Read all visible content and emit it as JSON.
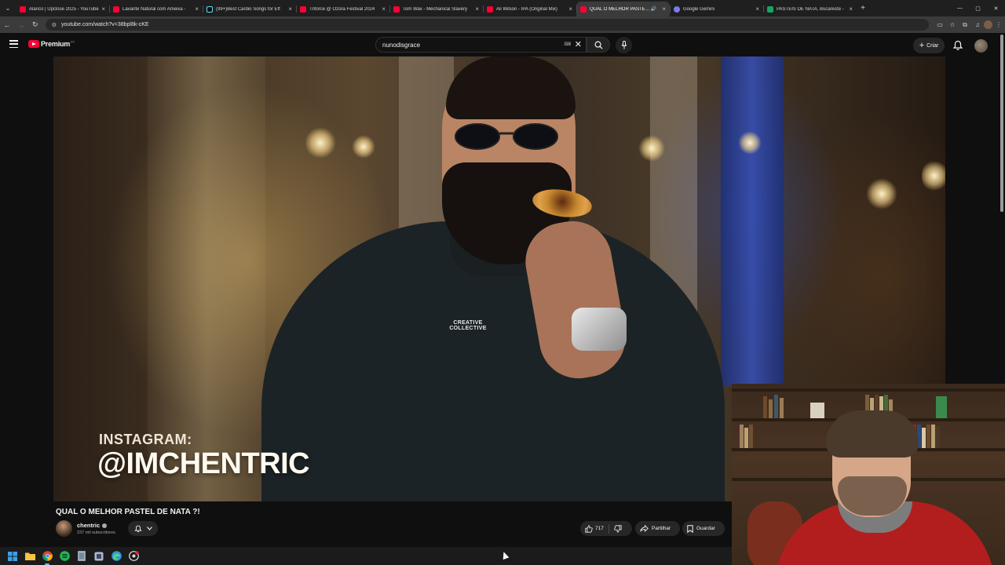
{
  "browser": {
    "tabs": [
      {
        "title": "Alarico | Upclose 2025 - YouTube",
        "favicon": "youtube-icon",
        "active": false,
        "audio": false
      },
      {
        "title": "Lavante Natural com Ameixa - ",
        "favicon": "youtube-icon",
        "active": false,
        "audio": false
      },
      {
        "title": "(99+)Best Cardio Songs for Eff",
        "favicon": "tiktok-icon",
        "active": false,
        "audio": false
      },
      {
        "title": "Triforce @ Ozora Festival 2024",
        "favicon": "youtube-icon",
        "active": false,
        "audio": false
      },
      {
        "title": "Tom Wax - Mechanical Slavery",
        "favicon": "youtube-icon",
        "active": false,
        "audio": false
      },
      {
        "title": "Ali Wilson - IPA (Original Mix)",
        "favicon": "youtube-icon",
        "active": false,
        "audio": false
      },
      {
        "title": "QUAL O MELHOR PASTEL D",
        "favicon": "youtube-icon",
        "active": true,
        "audio": true
      },
      {
        "title": "Google Gemini",
        "favicon": "gemini-icon",
        "active": false,
        "audio": false
      },
      {
        "title": "PASTEIS DE NATA, Bucareste - ",
        "favicon": "maps-icon",
        "active": false,
        "audio": false
      }
    ],
    "url": "youtube.com/watch?v=38bpl8k-cKE",
    "window_controls": [
      "—",
      "▢",
      "✕"
    ]
  },
  "youtube": {
    "logo_text": "Premium",
    "country_code": "PT",
    "search_query": "nunodisgrace",
    "create_label": "Criar",
    "video": {
      "overlay_label": "INSTAGRAM:",
      "overlay_handle": "@IMCHENTRIC",
      "shirt_text": "CREATIVE COLLECTIVE"
    },
    "title": "QUAL O MELHOR PASTEL DE NATA ?!",
    "channel": {
      "name": "chentric",
      "subscribers": "237 mil subscritores"
    },
    "actions": {
      "likes": "717",
      "share_label": "Partilhar",
      "save_label": "Guardar"
    }
  },
  "colors": {
    "yt_red": "#ff0033",
    "background": "#0f0f0f",
    "pill": "#272727"
  }
}
